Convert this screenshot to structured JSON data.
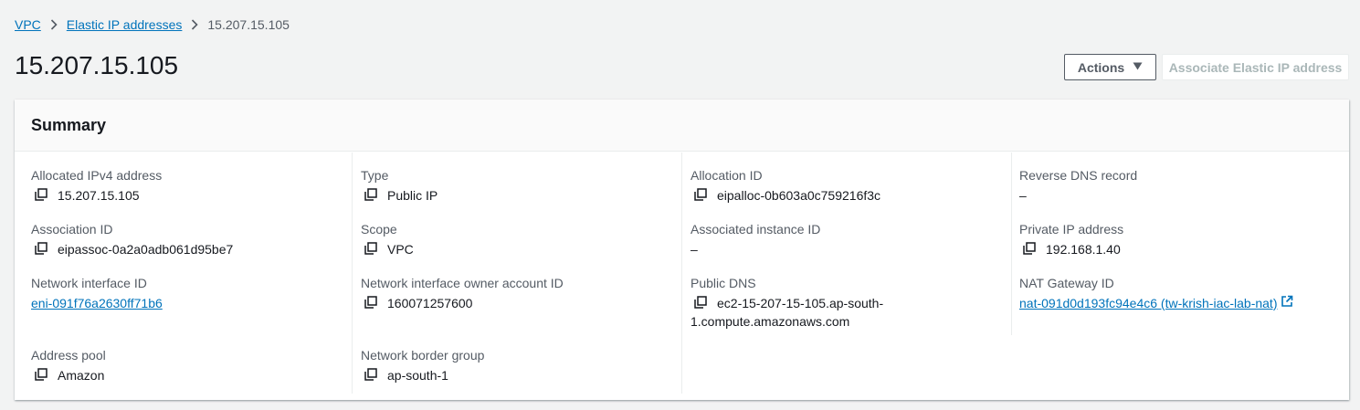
{
  "breadcrumb": {
    "items": [
      "VPC",
      "Elastic IP addresses"
    ],
    "current": "15.207.15.105"
  },
  "page_title": "15.207.15.105",
  "buttons": {
    "actions": "Actions",
    "associate": "Associate Elastic IP address"
  },
  "summary": {
    "title": "Summary",
    "allocated_ipv4": {
      "label": "Allocated IPv4 address",
      "value": "15.207.15.105"
    },
    "type": {
      "label": "Type",
      "value": "Public IP"
    },
    "allocation_id": {
      "label": "Allocation ID",
      "value": "eipalloc-0b603a0c759216f3c"
    },
    "reverse_dns": {
      "label": "Reverse DNS record",
      "value": "–"
    },
    "association_id": {
      "label": "Association ID",
      "value": "eipassoc-0a2a0adb061d95be7"
    },
    "scope": {
      "label": "Scope",
      "value": "VPC"
    },
    "associated_instance": {
      "label": "Associated instance ID",
      "value": "–"
    },
    "private_ip": {
      "label": "Private IP address",
      "value": "192.168.1.40"
    },
    "network_interface": {
      "label": "Network interface ID",
      "value": "eni-091f76a2630ff71b6"
    },
    "ni_owner": {
      "label": "Network interface owner account ID",
      "value": "160071257600"
    },
    "public_dns": {
      "label": "Public DNS",
      "value_line1": "ec2-15-207-15-105.ap-south-",
      "value_line2": "1.compute.amazonaws.com"
    },
    "nat_gateway": {
      "label": "NAT Gateway ID",
      "value": "nat-091d0d193fc94e4c6 (tw-krish-iac-lab-nat)"
    },
    "address_pool": {
      "label": "Address pool",
      "value": "Amazon"
    },
    "border_group": {
      "label": "Network border group",
      "value": "ap-south-1"
    }
  },
  "icons": [
    "chevron-right-icon",
    "caret-down-icon",
    "copy-icon",
    "external-link-icon"
  ],
  "colors": {
    "link": "#0073bb",
    "text": "#16191f",
    "muted": "#545b64",
    "background": "#f2f3f3"
  }
}
